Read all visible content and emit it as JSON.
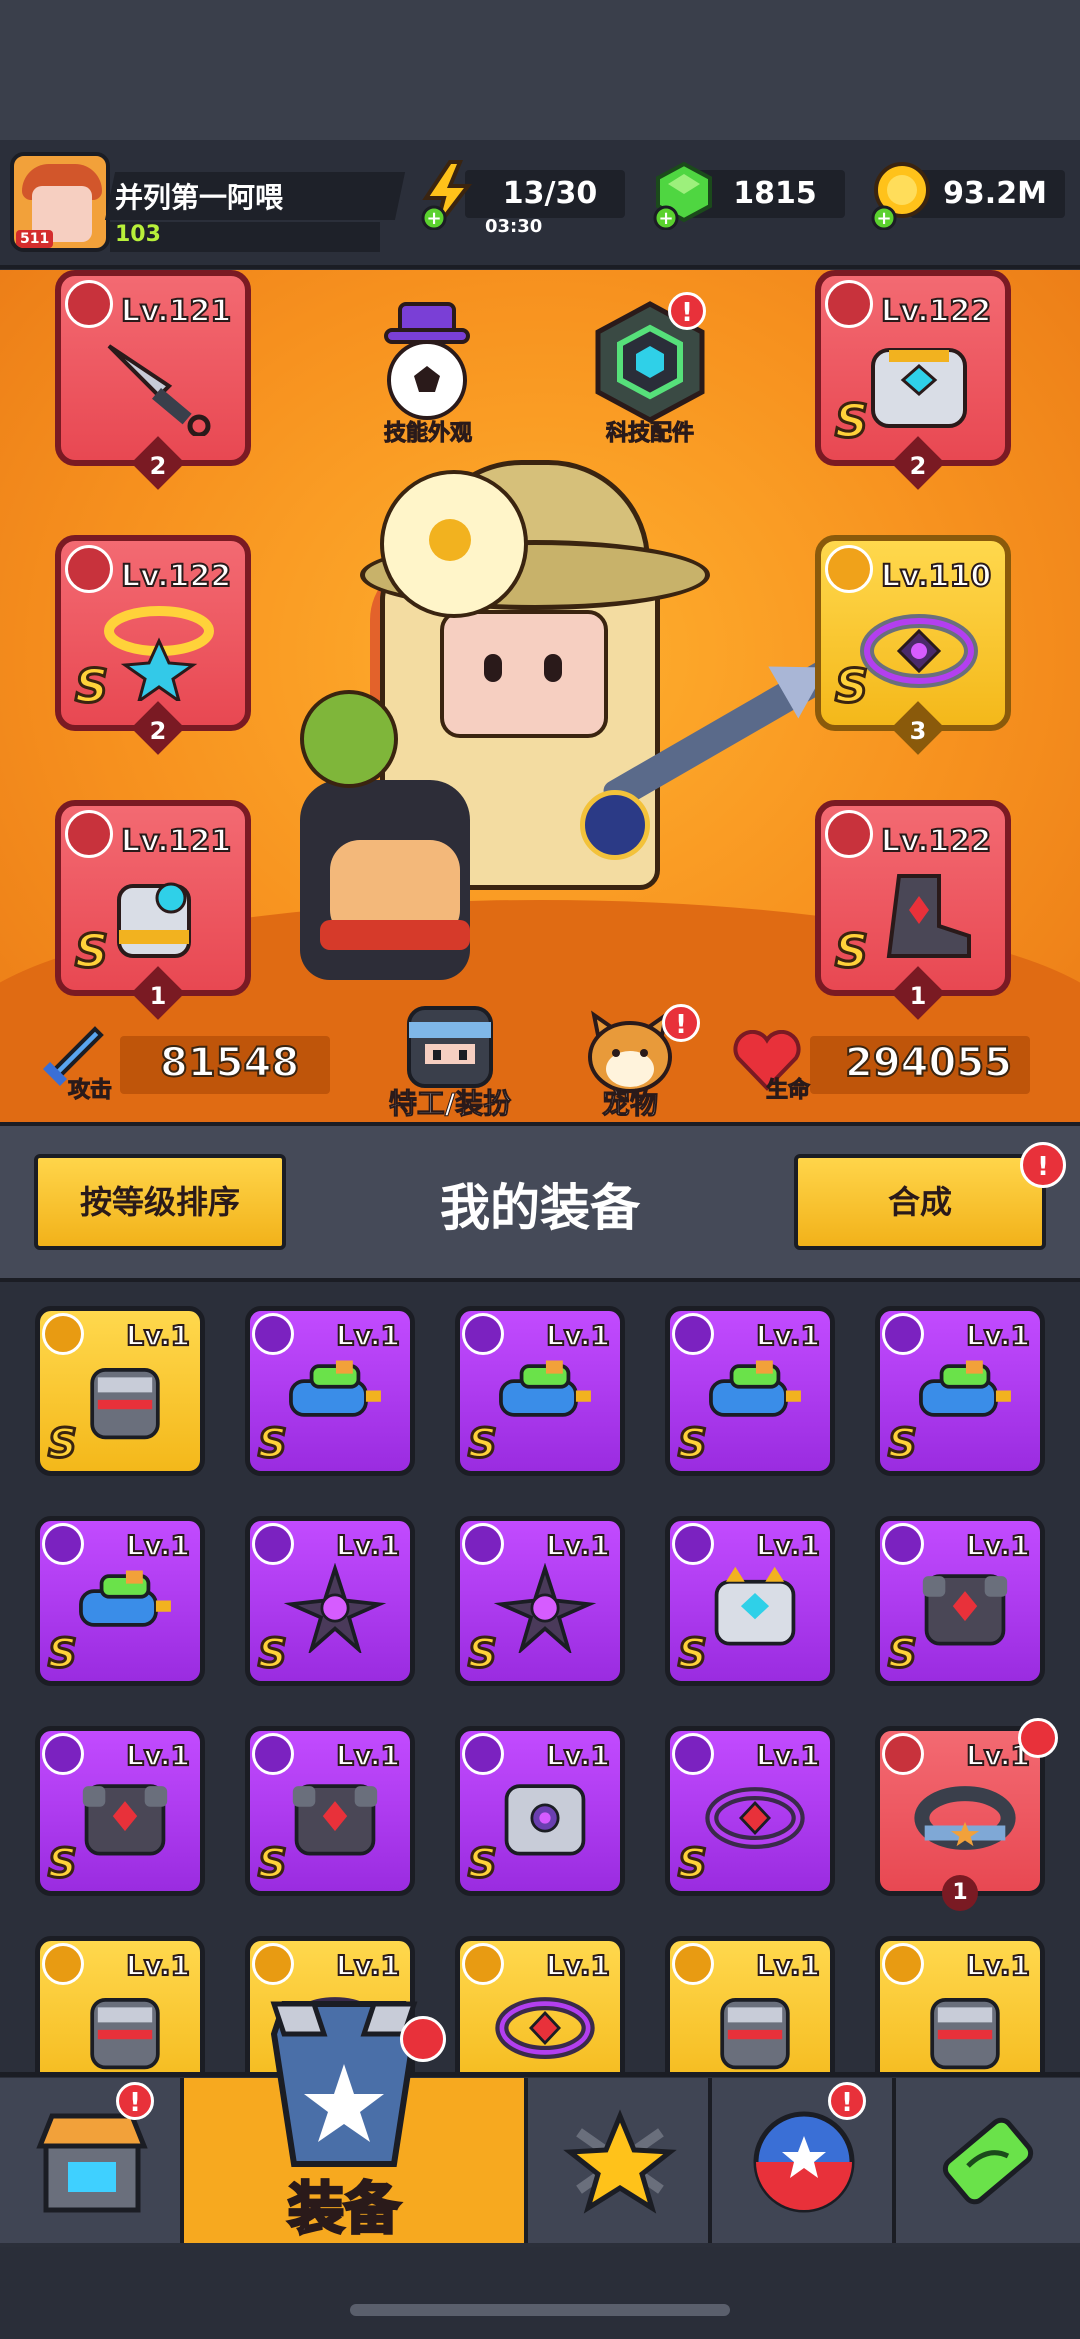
{
  "player": {
    "name": "并列第一阿喂",
    "level": "103",
    "avatar_level": "511"
  },
  "resources": {
    "energy": {
      "value": "13/30",
      "timer": "03:30",
      "icon": "lightning-icon"
    },
    "gems": {
      "value": "1815",
      "icon": "green-gem-icon"
    },
    "coins": {
      "value": "93.2M",
      "icon": "gold-coin-icon"
    }
  },
  "equipped": {
    "left": [
      {
        "level": "Lv.121",
        "count": "2",
        "type": "weapon",
        "grade": "",
        "frame": "red"
      },
      {
        "level": "Lv.122",
        "count": "2",
        "type": "necklace",
        "grade": "S",
        "frame": "red"
      },
      {
        "level": "Lv.121",
        "count": "1",
        "type": "gloves",
        "grade": "S",
        "frame": "red"
      }
    ],
    "right": [
      {
        "level": "Lv.122",
        "count": "2",
        "type": "armor",
        "grade": "S",
        "frame": "red"
      },
      {
        "level": "Lv.110",
        "count": "3",
        "type": "belt",
        "grade": "S",
        "frame": "yellow"
      },
      {
        "level": "Lv.122",
        "count": "1",
        "type": "boots",
        "grade": "S",
        "frame": "red"
      }
    ]
  },
  "features": {
    "skill_skin": "技能外观",
    "tech_parts": "科技配件",
    "agent": "特工/装扮",
    "pet": "宠物"
  },
  "stats": {
    "attack_label": "攻击",
    "attack": "81548",
    "hp_label": "生命",
    "hp": "294055"
  },
  "section": {
    "sort_button": "按等级排序",
    "title": "我的装备",
    "merge_button": "合成",
    "alert": "!"
  },
  "inventory": [
    {
      "level": "Lv.1",
      "frame": "yellow",
      "type": "gloves",
      "grade": "S"
    },
    {
      "level": "Lv.1",
      "frame": "purple",
      "type": "water-gun",
      "grade": "S"
    },
    {
      "level": "Lv.1",
      "frame": "purple",
      "type": "water-gun",
      "grade": "S"
    },
    {
      "level": "Lv.1",
      "frame": "purple",
      "type": "water-gun",
      "grade": "S"
    },
    {
      "level": "Lv.1",
      "frame": "purple",
      "type": "water-gun",
      "grade": "S"
    },
    {
      "level": "Lv.1",
      "frame": "purple",
      "type": "water-gun",
      "grade": "S"
    },
    {
      "level": "Lv.1",
      "frame": "purple",
      "type": "spike-blade",
      "grade": "S"
    },
    {
      "level": "Lv.1",
      "frame": "purple",
      "type": "spike-blade",
      "grade": "S"
    },
    {
      "level": "Lv.1",
      "frame": "purple",
      "type": "robot-armor",
      "grade": "S"
    },
    {
      "level": "Lv.1",
      "frame": "purple",
      "type": "dark-armor",
      "grade": "S"
    },
    {
      "level": "Lv.1",
      "frame": "purple",
      "type": "dark-armor",
      "grade": "S"
    },
    {
      "level": "Lv.1",
      "frame": "purple",
      "type": "dark-armor",
      "grade": "S"
    },
    {
      "level": "Lv.1",
      "frame": "purple",
      "type": "silver-armor",
      "grade": "S"
    },
    {
      "level": "Lv.1",
      "frame": "purple",
      "type": "belt",
      "grade": "S"
    },
    {
      "level": "Lv.1",
      "frame": "red",
      "type": "star-belt",
      "grade": "",
      "count": "1"
    },
    {
      "level": "Lv.1",
      "frame": "yellow",
      "type": "gloves",
      "grade": ""
    },
    {
      "level": "Lv.1",
      "frame": "yellow",
      "type": "belt",
      "grade": ""
    },
    {
      "level": "Lv.1",
      "frame": "yellow",
      "type": "belt",
      "grade": ""
    },
    {
      "level": "Lv.1",
      "frame": "yellow",
      "type": "gloves",
      "grade": ""
    },
    {
      "level": "Lv.1",
      "frame": "yellow",
      "type": "gloves",
      "grade": ""
    }
  ],
  "nav": {
    "shop": {
      "icon": "shop-icon"
    },
    "equipment": {
      "label": "装备",
      "icon": "equipment-icon"
    },
    "talent": {
      "icon": "star-swords-icon"
    },
    "skills": {
      "icon": "star-ball-icon"
    },
    "lab": {
      "icon": "dna-capsule-icon"
    }
  },
  "colors": {
    "accent": "#f7a91f",
    "purple": "#b03ff0",
    "red": "#e84852",
    "alert": "#e8313a"
  }
}
